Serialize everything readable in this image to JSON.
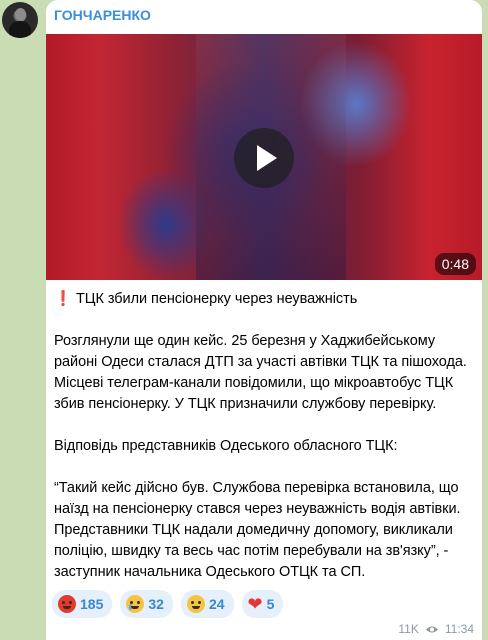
{
  "channel": {
    "name": "ГОНЧАРЕНКО"
  },
  "video": {
    "duration": "0:48"
  },
  "message": {
    "headline": "ТЦК збили пенсіонерку через неуважність",
    "headline_icon": "exclamation-icon",
    "paragraphs": [
      "Розглянули ще один кейс. 25 березня у Хаджибейському районі Одеси сталася ДТП за участі автівки ТЦК та пішохода. Місцеві телеграм-канали повідомили, що мікроавтобус ТЦК збив пенсіонерку. У ТЦК призначили службову перевірку.",
      "Відповідь представників Одеського обласного ТЦК:",
      "“Такий кейс дійсно був. Службова перевірка встановила, що наїзд на пенсіонерку стався через неуважність водія автівки. Представники ТЦК надали домедичну допомогу, викликали поліцію, швидку та весь час потім перебували на зв'язку”, - заступник начальника Одеського ОТЦК та СП."
    ]
  },
  "reactions": [
    {
      "icon": "angry-face-icon",
      "count": "185"
    },
    {
      "icon": "crying-face-icon",
      "count": "32"
    },
    {
      "icon": "grinning-face-icon",
      "count": "24"
    },
    {
      "icon": "red-heart-icon",
      "count": "5"
    }
  ],
  "meta": {
    "views": "11K",
    "time": "11:34"
  },
  "colors": {
    "accent": "#3a8fd8",
    "background": "#c9dcb4",
    "reaction_bg": "#e6f0fa"
  }
}
